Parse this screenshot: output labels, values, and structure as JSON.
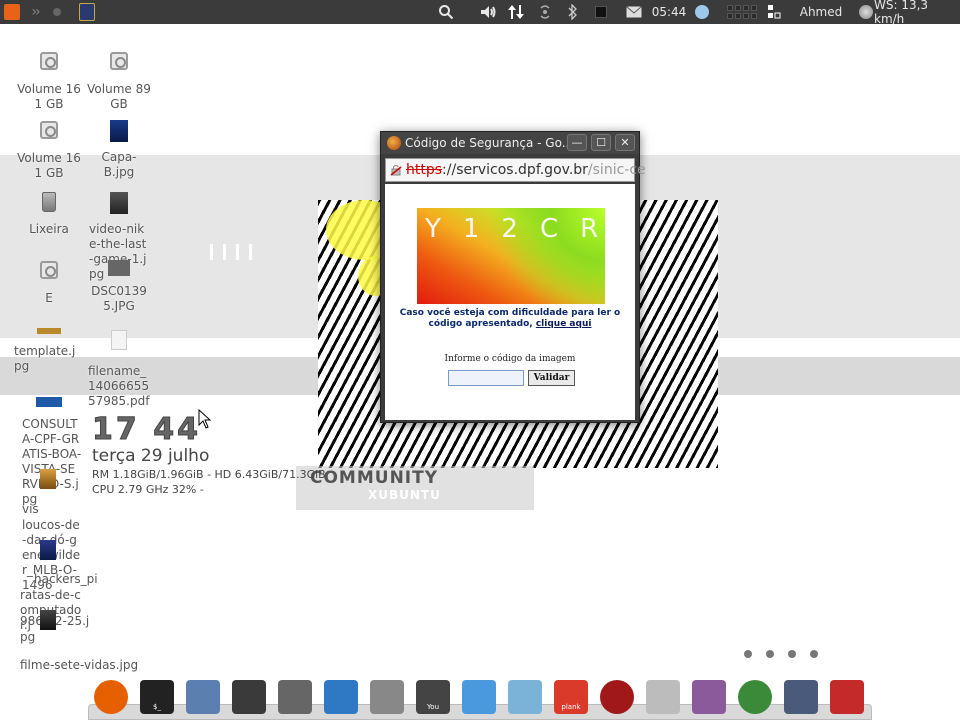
{
  "top_panel": {
    "clock": "05:44",
    "user": "Ahmed",
    "weather": "WS: 13,3 km/h",
    "icons": [
      "whisker-menu-icon",
      "chevrons-icon",
      "dot-icon",
      "shield-app-icon",
      "search-icon",
      "volume-icon",
      "network-updown-icon",
      "wifi-icon",
      "bluetooth-icon",
      "battery-icon",
      "mail-icon",
      "weather-cloud-icon",
      "workspace-switcher-icon",
      "user-icon",
      "weather-icon"
    ]
  },
  "desktop": {
    "icons": [
      {
        "label": "Volume 161 GB",
        "icon": "drive-icon"
      },
      {
        "label": "Volume 89 GB",
        "icon": "drive-icon"
      },
      {
        "label": "Volume 161 GB",
        "icon": "drive-icon"
      },
      {
        "label": "Capa-B.jpg",
        "icon": "image-file-icon"
      },
      {
        "label": "Lixeira",
        "icon": "trash-icon"
      },
      {
        "label": "video-nike-the-last-game-1.jpg",
        "icon": "image-file-icon"
      },
      {
        "label": "E",
        "icon": "drive-icon"
      },
      {
        "label": "DSC01395.JPG",
        "icon": "image-file-icon"
      },
      {
        "label": "template.jpg",
        "icon": "image-file-icon"
      },
      {
        "label": "filename_1406665557985.pdf",
        "icon": "pdf-file-icon"
      },
      {
        "label": "CONSULTA-CPF-GRATIS-BOA-VISTA-SERVICO-S.jpg",
        "icon": "image-file-icon"
      }
    ],
    "overlapping_labels": [
      "vis",
      "loucos-de-dar-dó-gene-wilder_MLB-O-1496",
      "hackers_pi",
      "ratas-de-computador.j",
      "986-02-25.j",
      "pg",
      "filme-sete-vidas.jpg"
    ]
  },
  "conky": {
    "time": "17 44",
    "date": "terça 29 julho",
    "line1": "RM 1.18GiB/1.96GiB - HD 6.43GiB/71.3GiB",
    "line2": "CPU 2.79 GHz 32% -"
  },
  "wallpaper": {
    "community": "COMMUNITY",
    "brand": "XUBUNTU"
  },
  "popup": {
    "title": "Código de Segurança - Go...",
    "url_scheme": "https",
    "url_host": "://servicos.dpf.gov.br",
    "url_path": "/sinic-ce",
    "captcha_code": "Y12CR",
    "help_text": "Caso você esteja com dificuldade para ler o código apresentado,",
    "help_link": "clique aqui",
    "input_label": "Informe o código da imagem",
    "submit_label": "Validar",
    "minimize_label": "—",
    "maximize_label": "☐",
    "close_label": "✕"
  },
  "dock": {
    "items": [
      {
        "name": "firefox",
        "color": "#e66000"
      },
      {
        "name": "terminal",
        "color": "#222222",
        "text": "$_"
      },
      {
        "name": "settings",
        "color": "#5a7fb0"
      },
      {
        "name": "file-manager",
        "color": "#3a3a3a"
      },
      {
        "name": "downloads",
        "color": "#666666"
      },
      {
        "name": "window",
        "color": "#2f78c4"
      },
      {
        "name": "search",
        "color": "#888888"
      },
      {
        "name": "youtube",
        "color": "#444444",
        "text": "You"
      },
      {
        "name": "download-manager",
        "color": "#4a98dd"
      },
      {
        "name": "network",
        "color": "#7ab2d8"
      },
      {
        "name": "plank",
        "color": "#d93a2a",
        "text": "plank"
      },
      {
        "name": "web-app",
        "color": "#a01818"
      },
      {
        "name": "home-folder",
        "color": "#bcbcbc"
      },
      {
        "name": "image-viewer",
        "color": "#8a5a9a"
      },
      {
        "name": "chrome",
        "color": "#3a8a3a"
      },
      {
        "name": "text-editor",
        "color": "#4a5a7a"
      },
      {
        "name": "pdf-reader",
        "color": "#c42a2a"
      }
    ]
  }
}
